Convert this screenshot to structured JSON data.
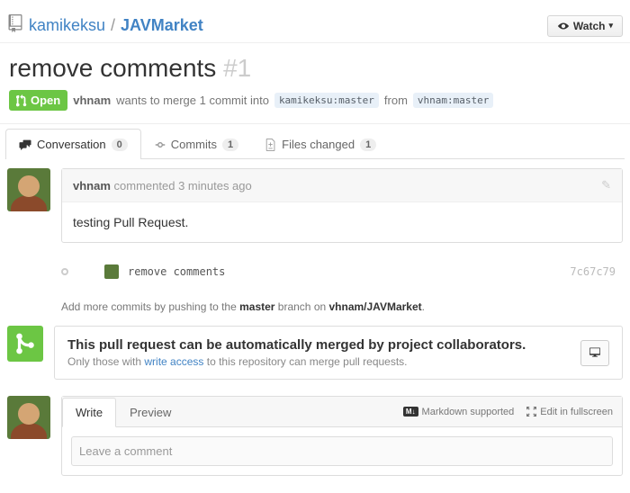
{
  "repo": {
    "owner": "kamikeksu",
    "name": "JAVMarket",
    "watch_label": "Watch"
  },
  "issue": {
    "title": "remove comments",
    "number": "#1",
    "state": "Open",
    "author": "vhnam",
    "merge_text_1": "wants to merge 1 commit into",
    "base": "kamikeksu:master",
    "merge_text_2": "from",
    "head": "vhnam:master"
  },
  "tabs": {
    "conversation": {
      "label": "Conversation",
      "count": "0"
    },
    "commits": {
      "label": "Commits",
      "count": "1"
    },
    "files": {
      "label": "Files changed",
      "count": "1"
    }
  },
  "comment": {
    "author": "vhnam",
    "verb": "commented",
    "time": "3 minutes ago",
    "body": "testing Pull Request."
  },
  "commit": {
    "msg": "remove comments",
    "sha": "7c67c79"
  },
  "push_hint": {
    "t1": "Add more commits by pushing to the ",
    "branch": "master",
    "t2": " branch on ",
    "path": "vhnam/JAVMarket",
    "t3": "."
  },
  "merge": {
    "title": "This pull request can be automatically merged by project collaborators.",
    "sub1": "Only those with ",
    "link": "write access",
    "sub2": " to this repository can merge pull requests."
  },
  "new_comment": {
    "write": "Write",
    "preview": "Preview",
    "markdown": "Markdown supported",
    "fullscreen": "Edit in fullscreen",
    "placeholder": "Leave a comment"
  }
}
